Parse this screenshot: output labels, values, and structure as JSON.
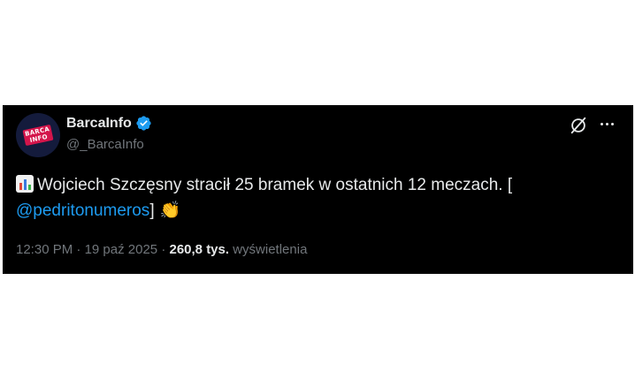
{
  "tweet": {
    "avatar": {
      "line1": "BARCA",
      "line2": "INFO",
      "badge_color": "#d4154b",
      "bg_color": "#141b3c"
    },
    "display_name": "BarcaInfo",
    "handle": "@_BarcaInfo",
    "verified": true,
    "icons": {
      "grok": "grok-icon",
      "more": "more-options-icon",
      "chart": "bar-chart-emoji",
      "hands": "clapping-hands-emoji"
    },
    "text_main": "Wojciech Szczęsny stracił 25 bramek w ostatnich 12 meczach. [",
    "mention": "@pedritonumeros",
    "text_after": "]",
    "hands_glyph": "👏",
    "time": "12:30 PM",
    "separator": "·",
    "date": "19 paź 2025",
    "views_count": "260,8 tys.",
    "views_label": "wyświetlenia",
    "colors": {
      "background": "#000000",
      "text": "#e7e9ea",
      "secondary": "#71767b",
      "link": "#1d9bf0",
      "verified": "#1d9bf0"
    }
  }
}
